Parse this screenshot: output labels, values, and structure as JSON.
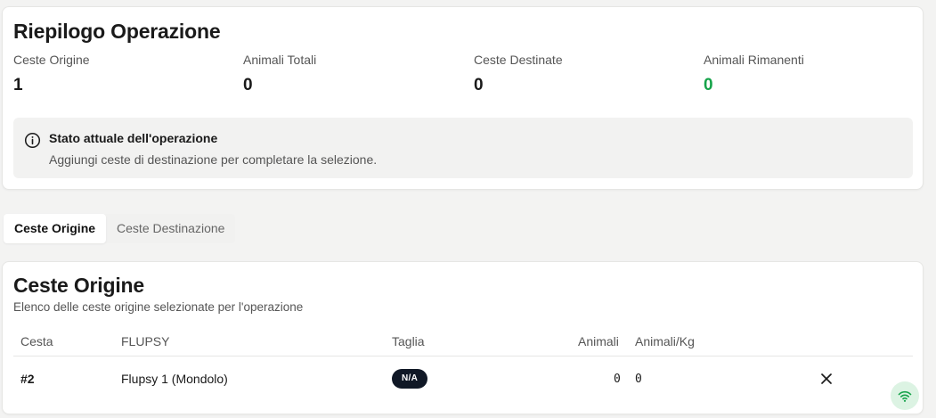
{
  "summary": {
    "title": "Riepilogo Operazione",
    "stats": [
      {
        "label": "Ceste Origine",
        "value": "1"
      },
      {
        "label": "Animali Totali",
        "value": "0"
      },
      {
        "label": "Ceste Destinate",
        "value": "0"
      },
      {
        "label": "Animali Rimanenti",
        "value": "0"
      }
    ],
    "info": {
      "icon": "info-circle-icon",
      "title": "Stato attuale dell'operazione",
      "text": "Aggiungi ceste di destinazione per completare la selezione."
    }
  },
  "tabs": [
    {
      "label": "Ceste Origine",
      "active": true
    },
    {
      "label": "Ceste Destinazione",
      "active": false
    }
  ],
  "origin": {
    "title": "Ceste Origine",
    "subtitle": "Elenco delle ceste origine selezionate per l'operazione",
    "columns": [
      "Cesta",
      "FLUPSY",
      "Taglia",
      "Animali",
      "Animali/Kg"
    ],
    "rows": [
      {
        "cesta": "#2",
        "flupsy": "Flupsy 1 (Mondolo)",
        "taglia": "N/A",
        "animali": "0",
        "animali_kg": "0"
      }
    ]
  },
  "colors": {
    "accent_green": "#16a34a",
    "badge_bg": "#101826",
    "wifi_bg": "#dcf3e3"
  },
  "icons": {
    "remove": "close-icon",
    "connection": "wifi-icon"
  }
}
